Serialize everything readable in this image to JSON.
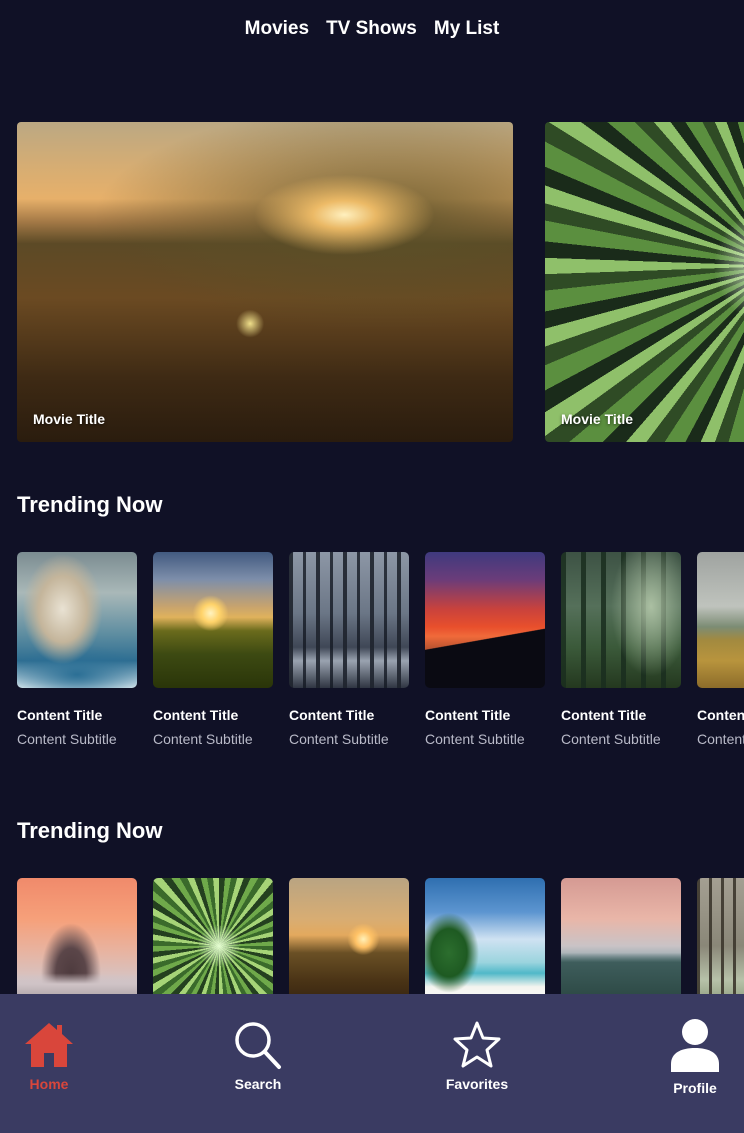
{
  "top_nav": {
    "items": [
      "Movies",
      "TV Shows",
      "My List"
    ]
  },
  "hero": {
    "cards": [
      {
        "title": "Movie Title",
        "image": "sunset-field"
      },
      {
        "title": "Movie Title",
        "image": "bamboo-forest"
      }
    ]
  },
  "sections": [
    {
      "title": "Trending Now",
      "items": [
        {
          "title": "Content Title",
          "subtitle": "Content Subtitle",
          "image": "storm-ship"
        },
        {
          "title": "Content Title",
          "subtitle": "Content Subtitle",
          "image": "flower-sunset"
        },
        {
          "title": "Content Title",
          "subtitle": "Content Subtitle",
          "image": "swamp"
        },
        {
          "title": "Content Title",
          "subtitle": "Content Subtitle",
          "image": "red-mountain"
        },
        {
          "title": "Content Title",
          "subtitle": "Content Subtitle",
          "image": "misty-forest"
        },
        {
          "title": "Content Title",
          "subtitle": "Content Subtitle",
          "image": "plains"
        }
      ]
    },
    {
      "title": "Trending Now",
      "items": [
        {
          "image": "mountain-peak"
        },
        {
          "image": "bamboo-forest"
        },
        {
          "image": "sunset-field"
        },
        {
          "image": "tropical-beach"
        },
        {
          "image": "pink-mountains"
        },
        {
          "image": "flooded-forest"
        }
      ]
    }
  ],
  "tab_bar": {
    "items": [
      {
        "label": "Home",
        "icon": "home-icon",
        "active": true
      },
      {
        "label": "Search",
        "icon": "search-icon",
        "active": false
      },
      {
        "label": "Favorites",
        "icon": "star-icon",
        "active": false
      },
      {
        "label": "Profile",
        "icon": "person-icon",
        "active": false
      }
    ]
  },
  "colors": {
    "background": "#101126",
    "tab_bar": "#3a3b62",
    "accent": "#d9463b",
    "subtitle": "#b9bac8"
  }
}
